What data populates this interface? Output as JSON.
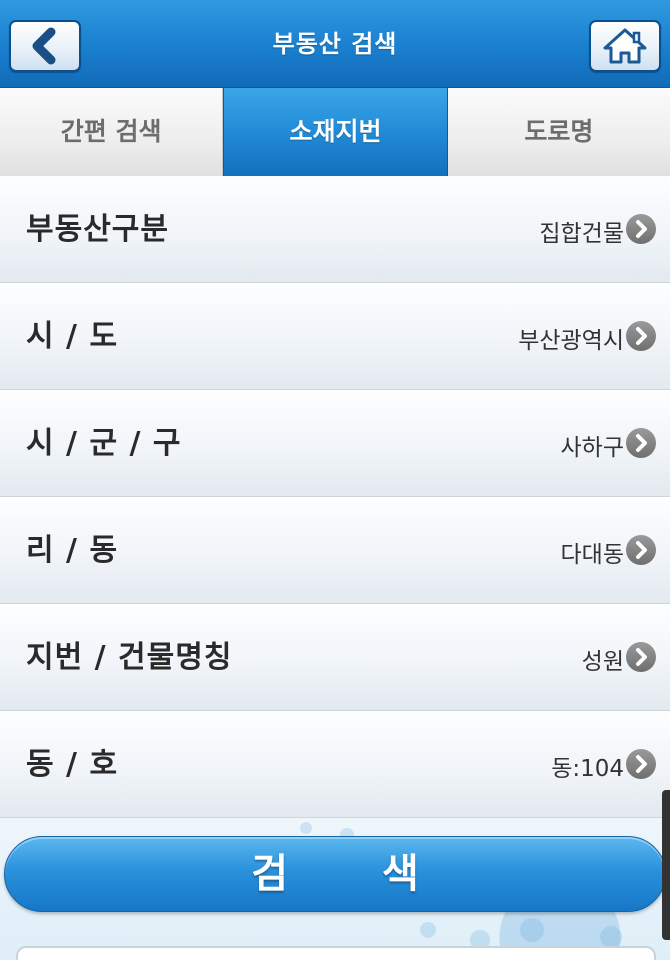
{
  "header": {
    "title": "부동산 검색",
    "back_icon": "chevron-left-icon",
    "home_icon": "home-icon"
  },
  "tabs": [
    {
      "label": "간편 검색",
      "active": false
    },
    {
      "label": "소재지번",
      "active": true
    },
    {
      "label": "도로명",
      "active": false
    }
  ],
  "rows": [
    {
      "label": "부동산구분",
      "value": "집합건물"
    },
    {
      "label": "시 / 도",
      "value": "부산광역시"
    },
    {
      "label": "시 / 군 / 구",
      "value": "사하구"
    },
    {
      "label": "리 / 동",
      "value": "다대동"
    },
    {
      "label": "지번 / 건물명칭",
      "value": "성원"
    },
    {
      "label": "동 / 호",
      "value": "동:104"
    }
  ],
  "search": {
    "button_label": "검 색"
  },
  "colors": {
    "header_blue": "#1a7fcf",
    "active_tab_blue": "#1f88d4",
    "arrow_gray": "#7a7a7a"
  }
}
